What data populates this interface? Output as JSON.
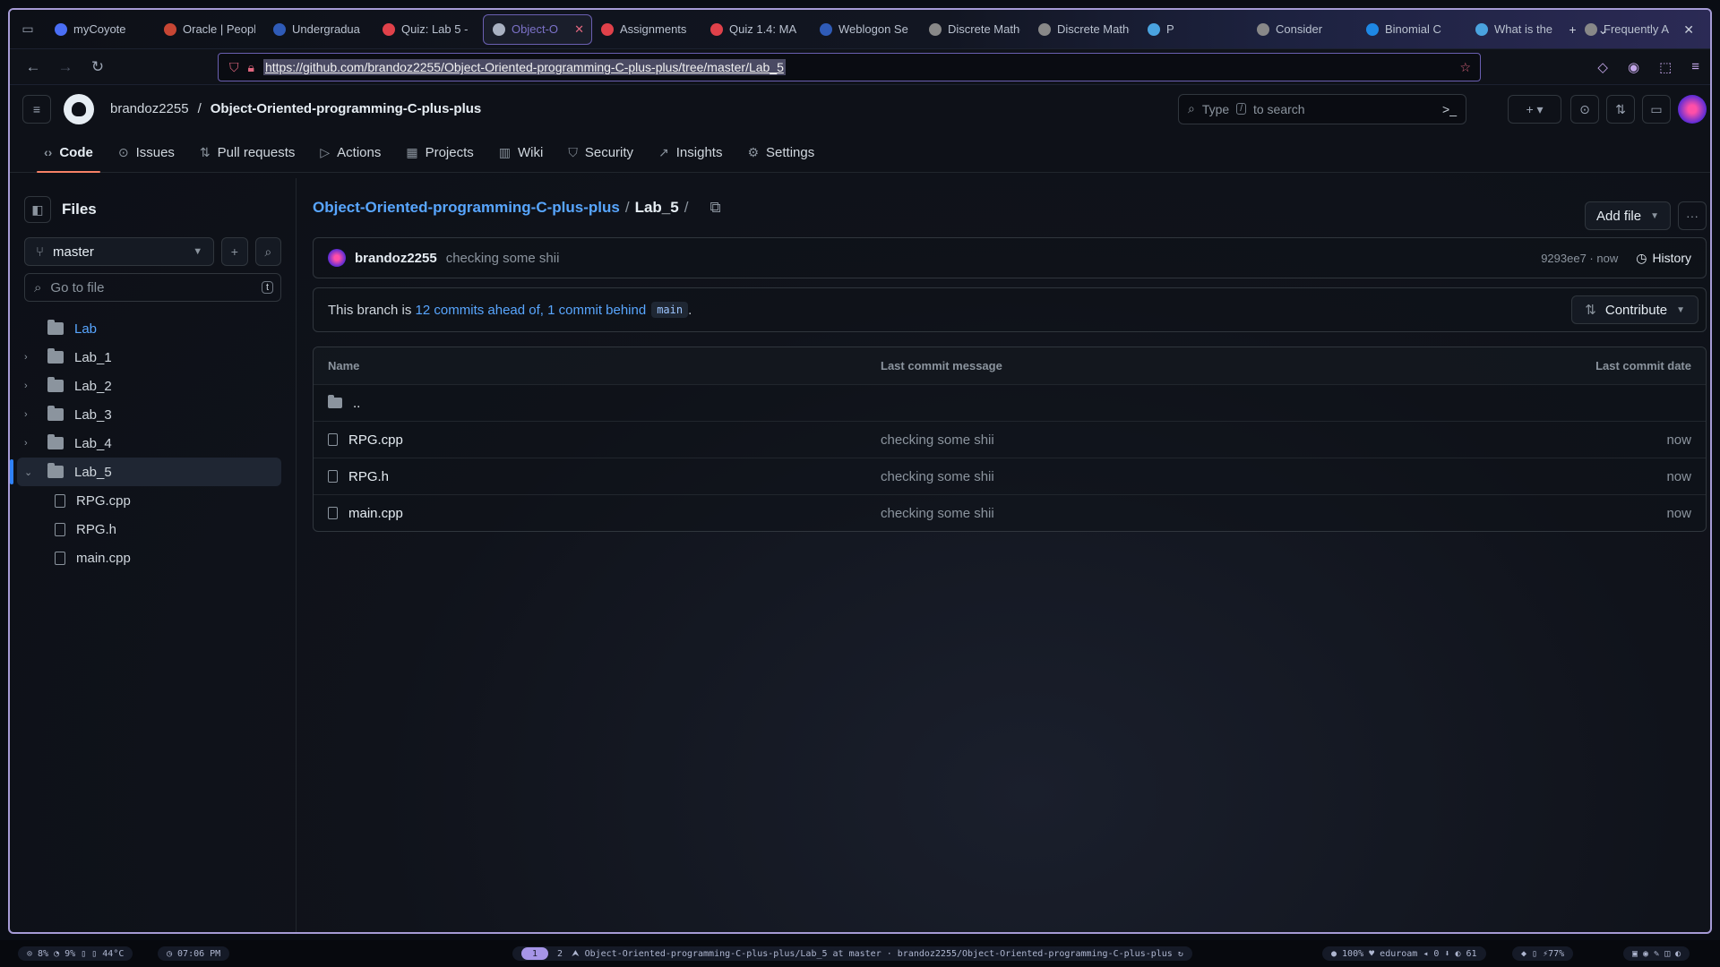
{
  "browser": {
    "tabs": [
      {
        "label": "myCoyote",
        "color": "#4a6ef5"
      },
      {
        "label": "Oracle | PeopleS",
        "color": "#c74634"
      },
      {
        "label": "Undergradua",
        "color": "#2f5bb7"
      },
      {
        "label": "Quiz: Lab 5 -",
        "color": "#e0414a"
      },
      {
        "label": "Object-O",
        "color": "#a9b1c2",
        "active": true
      },
      {
        "label": "Assignments",
        "color": "#e0414a"
      },
      {
        "label": "Quiz 1.4: MA",
        "color": "#e0414a"
      },
      {
        "label": "Weblogon Se",
        "color": "#2f5bb7"
      },
      {
        "label": "Discrete Mather",
        "color": "#888888"
      },
      {
        "label": "Discrete Mather",
        "color": "#888888"
      },
      {
        "label": "P",
        "color": "#4aa3df"
      },
      {
        "label": "Consider",
        "color": "#888888"
      },
      {
        "label": "Binomial C",
        "color": "#1e88e5"
      },
      {
        "label": "What is the",
        "color": "#4aa3df"
      },
      {
        "label": "Frequently A",
        "color": "#888888"
      }
    ],
    "url": "https://github.com/brandoz2255/Object-Oriented-programming-C-plus-plus/tree/master/Lab_5"
  },
  "header": {
    "owner": "brandoz2255",
    "separator": "/",
    "repo": "Object-Oriented-programming-C-plus-plus",
    "search_text_before": "Type",
    "search_key": "/",
    "search_text_after": "to search"
  },
  "repo_nav": [
    {
      "label": "Code",
      "icon": "code-icon",
      "active": true
    },
    {
      "label": "Issues",
      "icon": "issue-icon"
    },
    {
      "label": "Pull requests",
      "icon": "pull-request-icon"
    },
    {
      "label": "Actions",
      "icon": "play-icon"
    },
    {
      "label": "Projects",
      "icon": "table-icon"
    },
    {
      "label": "Wiki",
      "icon": "book-icon"
    },
    {
      "label": "Security",
      "icon": "shield-icon"
    },
    {
      "label": "Insights",
      "icon": "graph-icon"
    },
    {
      "label": "Settings",
      "icon": "gear-icon"
    }
  ],
  "sidebar": {
    "title": "Files",
    "branch": "master",
    "goto_placeholder": "Go to file",
    "goto_key": "t",
    "tree": [
      {
        "label": "Lab",
        "type": "folder",
        "link": true
      },
      {
        "label": "Lab_1",
        "type": "folder"
      },
      {
        "label": "Lab_2",
        "type": "folder"
      },
      {
        "label": "Lab_3",
        "type": "folder"
      },
      {
        "label": "Lab_4",
        "type": "folder"
      },
      {
        "label": "Lab_5",
        "type": "folder",
        "open": true,
        "selected": true
      },
      {
        "label": "RPG.cpp",
        "type": "file"
      },
      {
        "label": "RPG.h",
        "type": "file"
      },
      {
        "label": "main.cpp",
        "type": "file"
      }
    ]
  },
  "main": {
    "repo_link": "Object-Oriented-programming-C-plus-plus",
    "dir": "Lab_5",
    "sep": "/",
    "add_file": "Add file",
    "commit": {
      "user": "brandoz2255",
      "message": "checking some shii",
      "sha_time": "9293ee7 · now",
      "history": "History"
    },
    "branch_status": {
      "prefix": "This branch is",
      "ahead": "12 commits ahead of,",
      "behind": "1 commit behind",
      "base": "main",
      "suffix": ".",
      "contribute": "Contribute"
    },
    "table": {
      "headers": [
        "Name",
        "Last commit message",
        "Last commit date"
      ],
      "parent": "..",
      "rows": [
        {
          "name": "RPG.cpp",
          "message": "checking some shii",
          "date": "now"
        },
        {
          "name": "RPG.h",
          "message": "checking some shii",
          "date": "now"
        },
        {
          "name": "main.cpp",
          "message": "checking some shii",
          "date": "now"
        }
      ]
    }
  },
  "statusbar": {
    "system": "⊙ 8%  ◔ 9%  ▯ ▯ 44°C",
    "time": "◷ 07:06 PM",
    "ws1": "1",
    "ws2": "2",
    "title": "⮝ Object-Oriented-programming-C-plus-plus/Lab_5 at master · brandoz2255/Object-Oriented-programming-C-plus-plus ↻",
    "network": "● 100%  ♥ eduroam  ◂ 0  ⬇ ◐ 61",
    "battery": "◆ ▯ ⚡77%",
    "tray": "▣ ◉ ✎ ◫ ◐"
  }
}
